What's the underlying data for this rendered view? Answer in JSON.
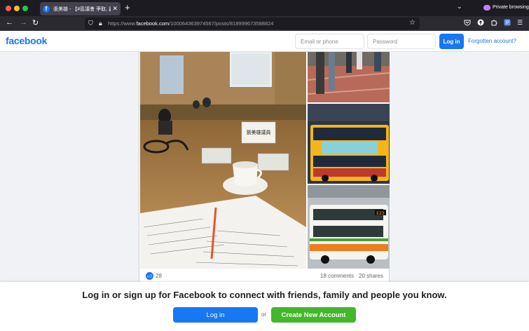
{
  "browser": {
    "tab_title": "張美雄 - 【#區議會 爭取, 盡力】",
    "tab_favicon": "f",
    "new_tab_icon": "+",
    "private_label": "Private browsing",
    "url_prefix": "https://www.",
    "url_domain": "facebook.com",
    "url_path": "/100064363974567/posts/818999673588824"
  },
  "header": {
    "logo": "facebook",
    "email_placeholder": "Email or phone",
    "password_placeholder": "Password",
    "login_label": "Log in",
    "forgot_label": "Forgotten account?"
  },
  "post": {
    "name_card_text": "張美雄議員",
    "bus_sign": "E23",
    "like_count": "28",
    "comments": "18 comments",
    "shares": "20 shares"
  },
  "banner": {
    "text": "Log in or sign up for Facebook to connect with friends, family and people you know.",
    "login_label": "Log in",
    "or_label": "or",
    "create_label": "Create New Account"
  },
  "colors": {
    "brand": "#1877f2",
    "create_green": "#42b72a"
  }
}
